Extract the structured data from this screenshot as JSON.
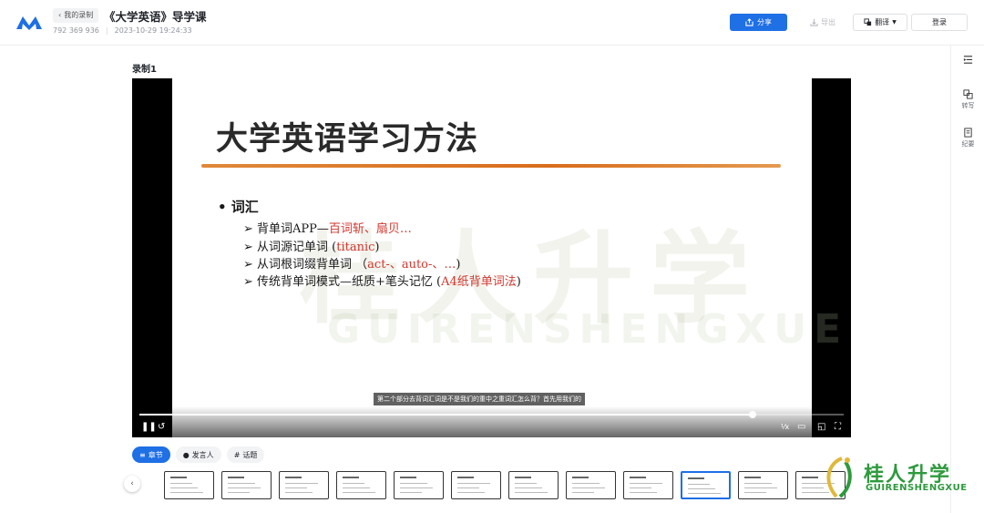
{
  "header": {
    "back_label": "我的录制",
    "title": "《大学英语》导学课",
    "meeting_id": "792 369 936",
    "datetime": "2023-10-29 19:24:33",
    "share_label": "分享",
    "export_label": "导出",
    "translate_label": "翻译",
    "login_label": "登录"
  },
  "right_rail": {
    "items": [
      {
        "icon": "outline-icon",
        "label": ""
      },
      {
        "icon": "transcript-icon",
        "label": "转写"
      },
      {
        "icon": "minutes-icon",
        "label": "纪要"
      }
    ]
  },
  "recording": {
    "title": "录制1"
  },
  "slide": {
    "title": "大学英语学习方法",
    "bullet": "• 词汇",
    "items": [
      {
        "prefix": "➢ 背单词APP—",
        "highlight": "百词斩、扇贝…",
        "suffix": ""
      },
      {
        "prefix": "➢ 从词源记单词 (",
        "highlight": "titanic",
        "suffix": ")"
      },
      {
        "prefix": "➢ 从词根词缀背单词 （",
        "highlight": "act-、auto-、…",
        "suffix": ")"
      },
      {
        "prefix": "➢ 传统背单词模式—纸质+笔头记忆 (",
        "highlight": "A4纸背单词法",
        "suffix": ")"
      }
    ],
    "watermark_cn": "桂人升学",
    "watermark_en": "GUIRENSHENGXUE"
  },
  "player": {
    "subtitle": "第二个部分去背词汇词是不是我们的重中之重词汇怎么背？首先用我们的",
    "progress": 0.87
  },
  "tabs": [
    {
      "label": "章节",
      "icon": "chapter-icon",
      "active": true
    },
    {
      "label": "发言人",
      "icon": "user-icon",
      "active": false
    },
    {
      "label": "话题",
      "icon": "hash-icon",
      "active": false
    }
  ],
  "thumbnails": {
    "count": 12,
    "active_index": 9
  },
  "corner_logo": {
    "cn": "桂人升学",
    "en": "GUIRENSHENGXUE"
  },
  "colors": {
    "accent": "#1f6fe5",
    "slide_red": "#d2362d",
    "slide_orange": "#d96d1c",
    "logo_green": "#2e9a3d"
  }
}
